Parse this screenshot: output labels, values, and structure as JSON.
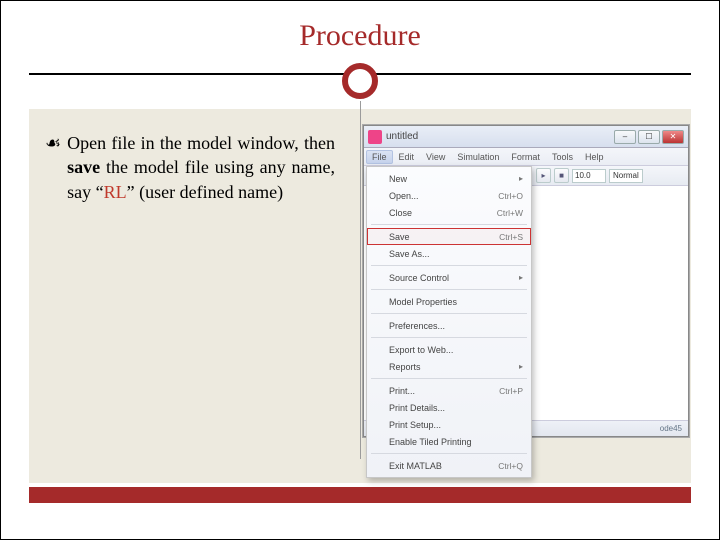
{
  "title": "Procedure",
  "body": {
    "bullet_glyph": "☙",
    "text_before_save": "Open file in the model window, then ",
    "save_word": "save",
    "text_before_rl": " the model file using any name, say “",
    "rl_word": "RL",
    "text_after_rl": "” (user defined name)"
  },
  "window": {
    "title": "untitled",
    "menus": [
      "File",
      "Edit",
      "View",
      "Simulation",
      "Format",
      "Tools",
      "Help"
    ],
    "toolbar_time": "10.0",
    "toolbar_mode": "Normal",
    "status_solver": "ode45",
    "win_min": "–",
    "win_max": "☐",
    "win_close": "✕",
    "play": "▸",
    "stop": "■"
  },
  "file_menu": {
    "items": [
      {
        "label": "New",
        "shortcut": "",
        "submenu": true
      },
      {
        "label": "Open...",
        "shortcut": "Ctrl+O"
      },
      {
        "label": "Close",
        "shortcut": "Ctrl+W"
      },
      {
        "sep": true
      },
      {
        "label": "Save",
        "shortcut": "Ctrl+S",
        "highlight": true
      },
      {
        "label": "Save As...",
        "shortcut": ""
      },
      {
        "sep": true
      },
      {
        "label": "Source Control",
        "shortcut": "",
        "submenu": true
      },
      {
        "sep": true
      },
      {
        "label": "Model Properties",
        "shortcut": ""
      },
      {
        "sep": true
      },
      {
        "label": "Preferences...",
        "shortcut": ""
      },
      {
        "sep": true
      },
      {
        "label": "Export to Web...",
        "shortcut": ""
      },
      {
        "label": "Reports",
        "shortcut": "",
        "submenu": true
      },
      {
        "sep": true
      },
      {
        "label": "Print...",
        "shortcut": "Ctrl+P"
      },
      {
        "label": "Print Details...",
        "shortcut": ""
      },
      {
        "label": "Print Setup...",
        "shortcut": ""
      },
      {
        "label": "Enable Tiled Printing",
        "shortcut": ""
      },
      {
        "sep": true
      },
      {
        "label": "Exit MATLAB",
        "shortcut": "Ctrl+Q"
      }
    ]
  }
}
